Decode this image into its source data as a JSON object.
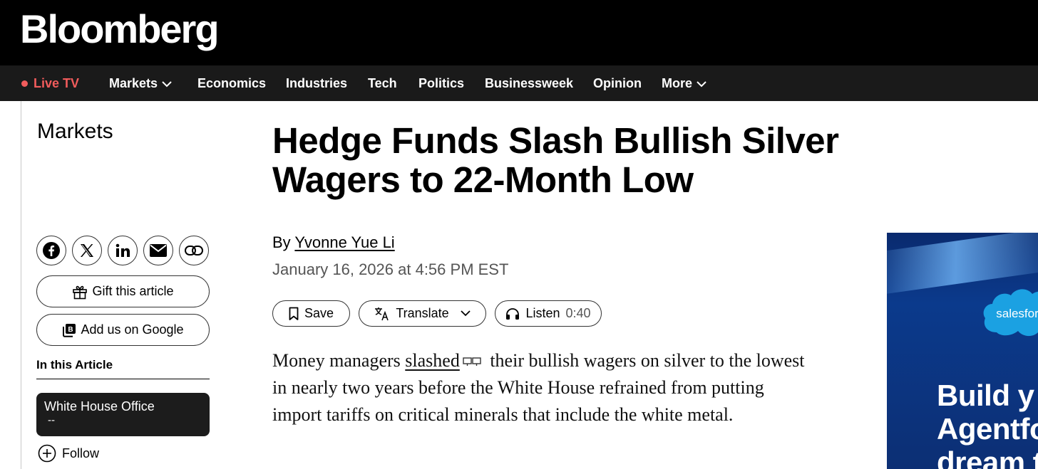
{
  "brand": {
    "logo_text": "Bloomberg"
  },
  "nav": {
    "live_label": "Live TV",
    "items": [
      {
        "label": "Markets",
        "has_dropdown": true
      },
      {
        "label": "Economics"
      },
      {
        "label": "Industries"
      },
      {
        "label": "Tech"
      },
      {
        "label": "Politics"
      },
      {
        "label": "Businessweek"
      },
      {
        "label": "Opinion"
      },
      {
        "label": "More",
        "has_dropdown": true
      }
    ]
  },
  "rail": {
    "section": "Markets",
    "share_icons": [
      "facebook-icon",
      "x-icon",
      "linkedin-icon",
      "email-icon",
      "link-icon"
    ],
    "gift_label": "Gift this article",
    "google_label": "Add us on Google",
    "in_article_label": "In this Article",
    "ticker": {
      "name": "White House Office",
      "value": "--"
    },
    "follow_label": "Follow"
  },
  "article": {
    "headline": "Hedge Funds Slash Bullish Silver Wagers to 22-Month Low",
    "byline_prefix": "By",
    "author": "Yvonne Yue Li",
    "date": "January 16, 2026 at 4:56 PM EST",
    "actions": {
      "save_label": "Save",
      "translate_label": "Translate",
      "listen_label": "Listen",
      "listen_duration": "0:40"
    },
    "body": {
      "before_link": "Money managers ",
      "link_text": "slashed",
      "after_link": " their bullish wagers on silver to the lowest in nearly two years before the White House refrained from putting import tariffs on critical minerals that include the white metal."
    }
  },
  "ad": {
    "brand_text": "salesforce",
    "headline_lines": [
      "Build y",
      "Agentfo",
      "dream t"
    ]
  },
  "colors": {
    "live_red": "#f25c5c",
    "nav_bg": "#1a1a1a",
    "ad_blue": "#0b3a8c",
    "salesforce_blue": "#1ba1e2"
  }
}
